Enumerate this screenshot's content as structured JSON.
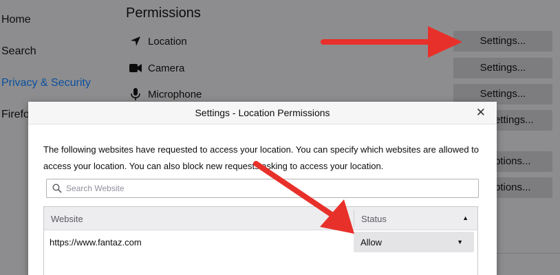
{
  "sidebar": {
    "items": [
      {
        "label": "Home"
      },
      {
        "label": "Search"
      },
      {
        "label": "Privacy & Security"
      },
      {
        "label": "Firefo"
      }
    ]
  },
  "permissions": {
    "heading": "Permissions",
    "rows": [
      {
        "label": "Location",
        "icon": "location-arrow-icon"
      },
      {
        "label": "Camera",
        "icon": "camera-icon"
      },
      {
        "label": "Microphone",
        "icon": "microphone-icon"
      }
    ],
    "buttons": [
      "Settings...",
      "Settings...",
      "Settings...",
      "ettings...",
      "ptions...",
      "ptions..."
    ]
  },
  "dialog": {
    "title": "Settings - Location Permissions",
    "description": "The following websites have requested to access your location. You can specify which websites are allowed to access your location. You can also block new requests asking to access your location.",
    "search_placeholder": "Search Website",
    "columns": {
      "website": "Website",
      "status": "Status"
    },
    "rows": [
      {
        "website": "https://www.fantaz.com",
        "status": "Allow"
      }
    ]
  },
  "colors": {
    "annotation_red": "#e8302a",
    "link_blue": "#0a4f9e"
  }
}
